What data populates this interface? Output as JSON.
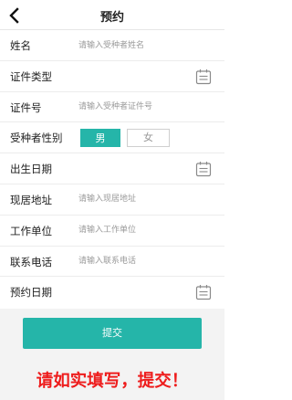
{
  "header": {
    "title": "预约",
    "back_icon": "chevron-left-icon"
  },
  "form": {
    "name": {
      "label": "姓名",
      "placeholder": "请输入受种者姓名",
      "value": ""
    },
    "id_type": {
      "label": "证件类型",
      "icon": "calendar-icon"
    },
    "id_number": {
      "label": "证件号",
      "placeholder": "请输入受种者证件号",
      "value": ""
    },
    "gender": {
      "label": "受种者性别",
      "options": [
        "男",
        "女"
      ],
      "selected": "男"
    },
    "birth_date": {
      "label": "出生日期",
      "icon": "calendar-icon"
    },
    "address": {
      "label": "现居地址",
      "placeholder": "请输入现居地址",
      "value": ""
    },
    "employer": {
      "label": "工作单位",
      "placeholder": "请输入工作单位",
      "value": ""
    },
    "phone": {
      "label": "联系电话",
      "placeholder": "请输入联系电话",
      "value": ""
    },
    "appointment_date": {
      "label": "预约日期",
      "icon": "calendar-icon"
    }
  },
  "footer": {
    "submit_label": "提交",
    "warning_text": "请如实填写，提交！"
  },
  "colors": {
    "accent": "#25b5a9",
    "warning": "#ee1c1c",
    "footer_bg": "#f3f3f3"
  }
}
